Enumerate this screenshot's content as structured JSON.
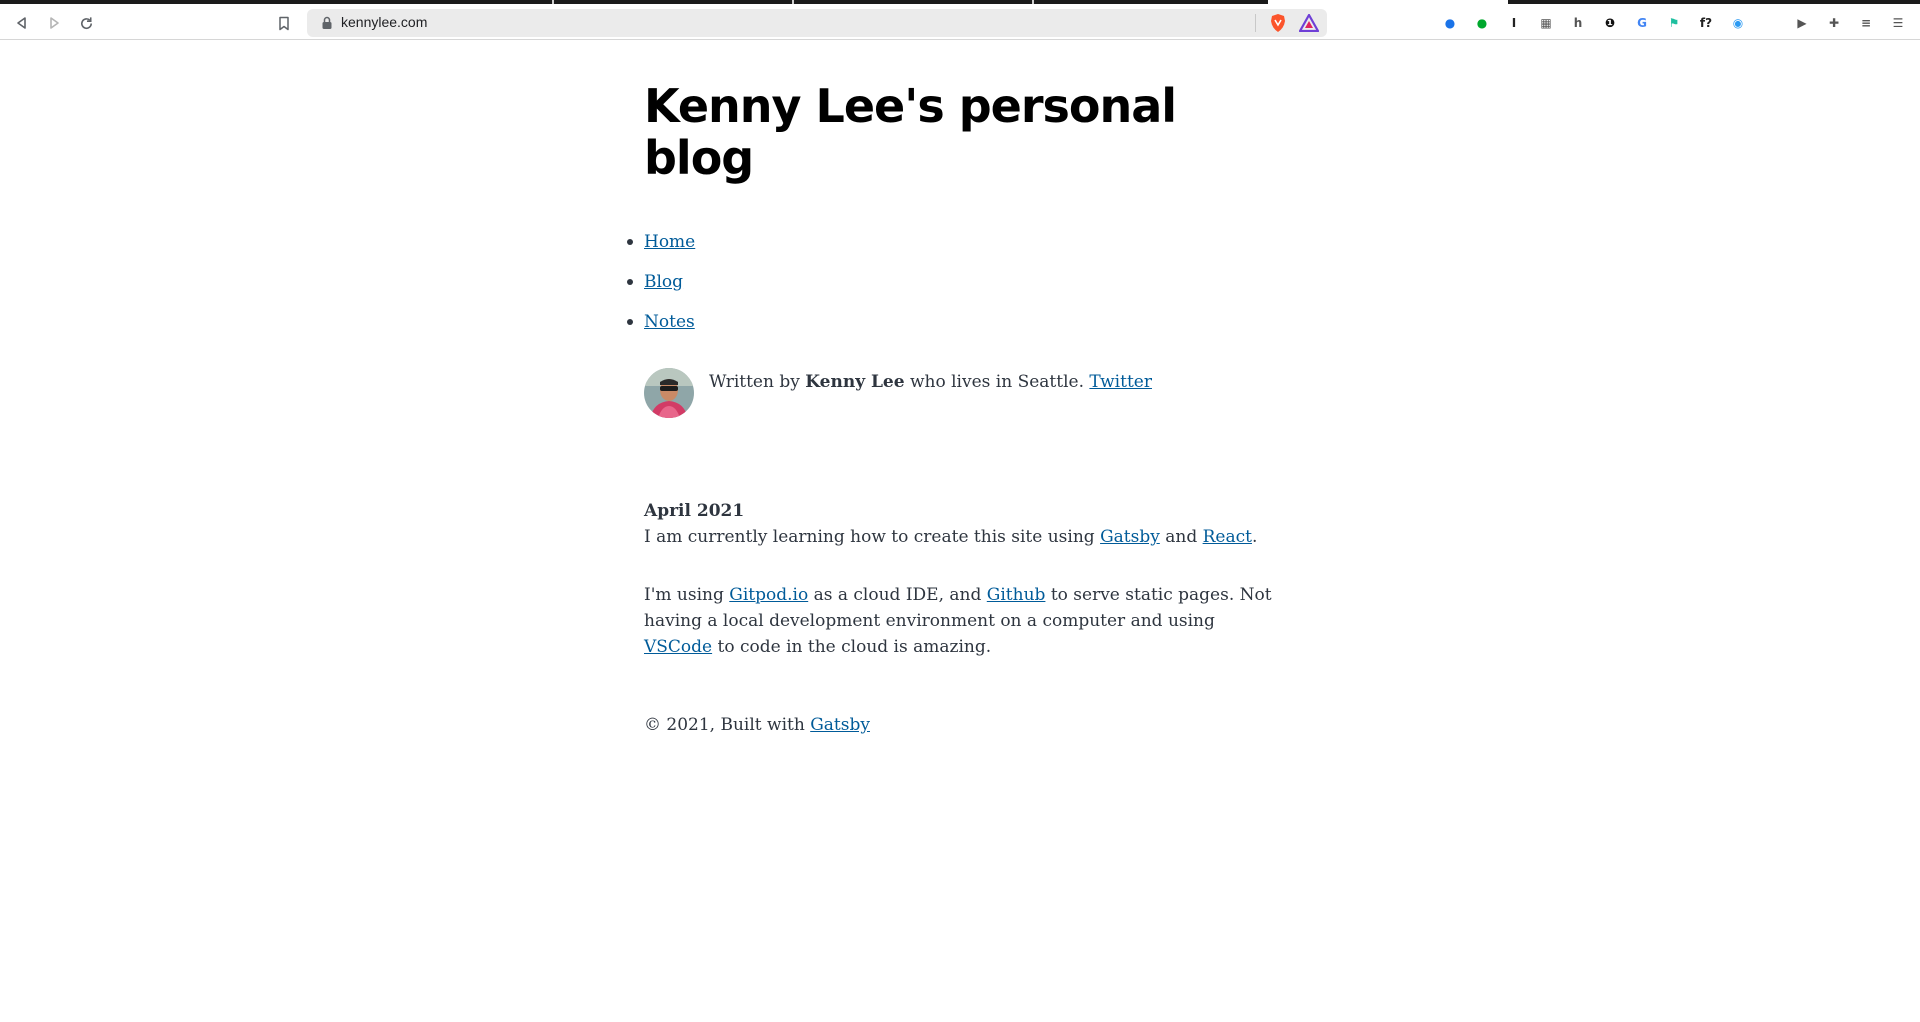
{
  "browser": {
    "url": "kennylee.com",
    "nav_buttons": {
      "back": "◁",
      "forward": "▷",
      "reload": "↻",
      "bookmark": "🔖"
    },
    "extensions": [
      {
        "name": "1password-like-icon",
        "glyph": "●",
        "color": "#1a73e8"
      },
      {
        "name": "evernote-icon",
        "glyph": "●",
        "color": "#00a82d"
      },
      {
        "name": "instapaper-icon",
        "glyph": "I",
        "color": "#222222"
      },
      {
        "name": "qr-code-icon",
        "glyph": "▦",
        "color": "#555555"
      },
      {
        "name": "h-extension-icon",
        "glyph": "h",
        "color": "#555555"
      },
      {
        "name": "onepassword-icon",
        "glyph": "❶",
        "color": "#111111"
      },
      {
        "name": "google-translate-icon",
        "glyph": "G",
        "color": "#4285f4"
      },
      {
        "name": "feather-extension-icon",
        "glyph": "⚑",
        "color": "#1dbf9f"
      },
      {
        "name": "font-finder-icon",
        "glyph": "f?",
        "color": "#222222"
      },
      {
        "name": "blue-circle-extension-icon",
        "glyph": "◉",
        "color": "#2b9af3"
      },
      {
        "name": "video-extension-icon",
        "glyph": "▶",
        "color": "#555555"
      },
      {
        "name": "extensions-puzzle-icon",
        "glyph": "✚",
        "color": "#555555"
      },
      {
        "name": "reading-list-icon",
        "glyph": "≡",
        "color": "#555555"
      },
      {
        "name": "menu-icon",
        "glyph": "☰",
        "color": "#555555"
      }
    ]
  },
  "page": {
    "title": "Kenny Lee's personal blog",
    "nav": [
      {
        "label": "Home"
      },
      {
        "label": "Blog"
      },
      {
        "label": "Notes"
      }
    ],
    "bio": {
      "prefix": "Written by ",
      "author": "Kenny Lee",
      "middle": " who lives in Seattle. ",
      "twitter": "Twitter"
    },
    "post": {
      "date": "April 2021",
      "p1_a": "I am currently learning how to create this site using ",
      "p1_link1": "Gatsby",
      "p1_b": " and ",
      "p1_link2": "React",
      "p1_c": ".",
      "p2_a": "I'm using ",
      "p2_link1": "Gitpod.io",
      "p2_b": " as a cloud IDE, and ",
      "p2_link2": "Github",
      "p2_c": " to serve static pages. Not having a local development environment on a computer and using ",
      "p2_link3": "VSCode",
      "p2_d": " to code in the cloud is amazing."
    },
    "footer": {
      "text": "© 2021, Built with ",
      "link": "Gatsby"
    }
  },
  "colors": {
    "link": "#005b99",
    "text": "#2e353f",
    "title": "#000000"
  }
}
